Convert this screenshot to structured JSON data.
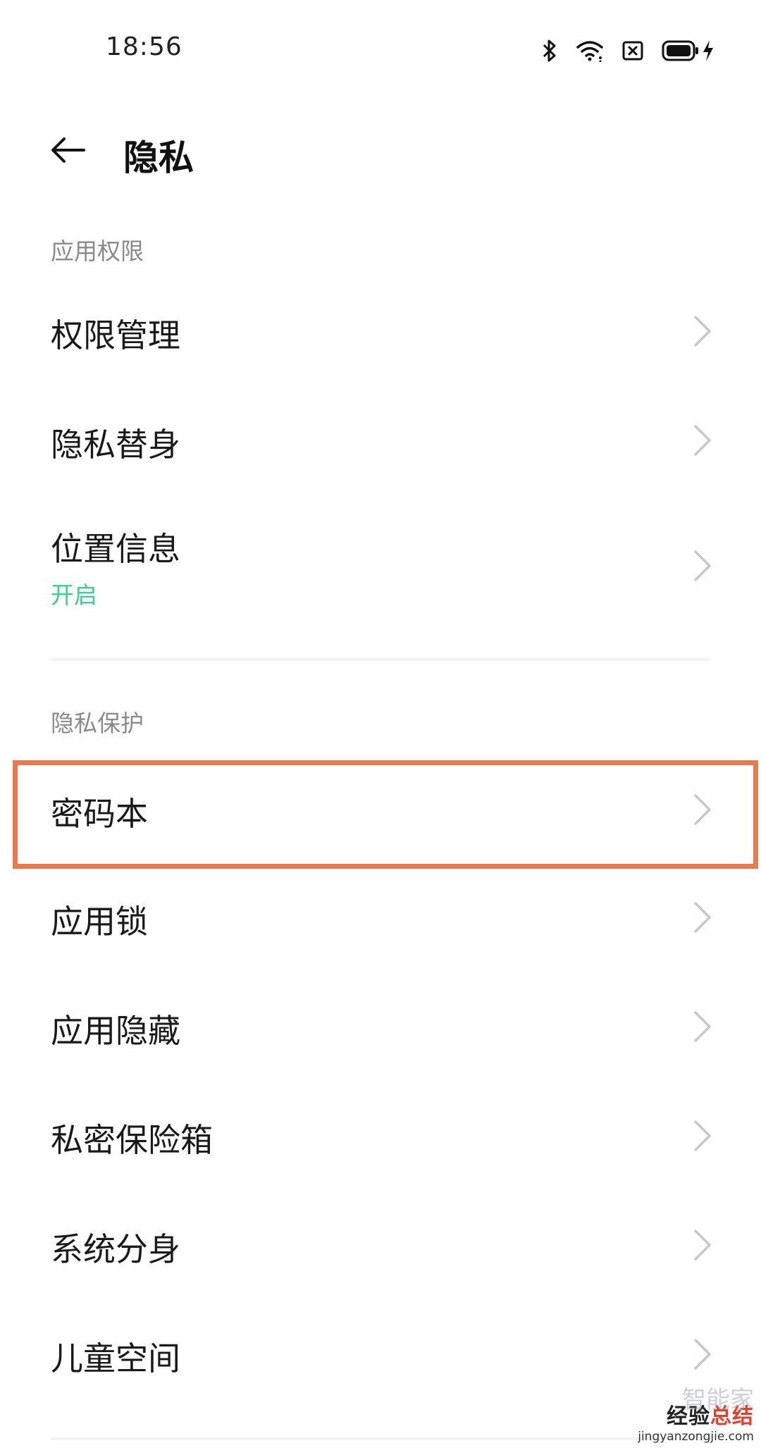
{
  "status_bar": {
    "time": "18:56",
    "icons": [
      "bluetooth-icon",
      "wifi-icon",
      "no-sim-icon",
      "battery-icon",
      "charging-bolt-icon"
    ]
  },
  "header": {
    "title": "隐私",
    "back_icon": "arrow-left-icon"
  },
  "sections": [
    {
      "label": "应用权限",
      "items": [
        {
          "label": "权限管理"
        },
        {
          "label": "隐私替身"
        },
        {
          "label": "位置信息",
          "sub": "开启"
        }
      ]
    },
    {
      "label": "隐私保护",
      "items": [
        {
          "label": "密码本",
          "highlighted": true
        },
        {
          "label": "应用锁"
        },
        {
          "label": "应用隐藏"
        },
        {
          "label": "私密保险箱"
        },
        {
          "label": "系统分身"
        },
        {
          "label": "儿童空间"
        }
      ]
    }
  ],
  "colors": {
    "accent_green": "#3ccf8e",
    "highlight_border": "#ea7a4c",
    "section_label": "#8a8a8a",
    "chevron": "#c8c8c8"
  },
  "watermark": {
    "line1_part1": "经验",
    "line1_accent": "总结",
    "faint": "智能家",
    "url": "jingyanzongjie.com"
  }
}
